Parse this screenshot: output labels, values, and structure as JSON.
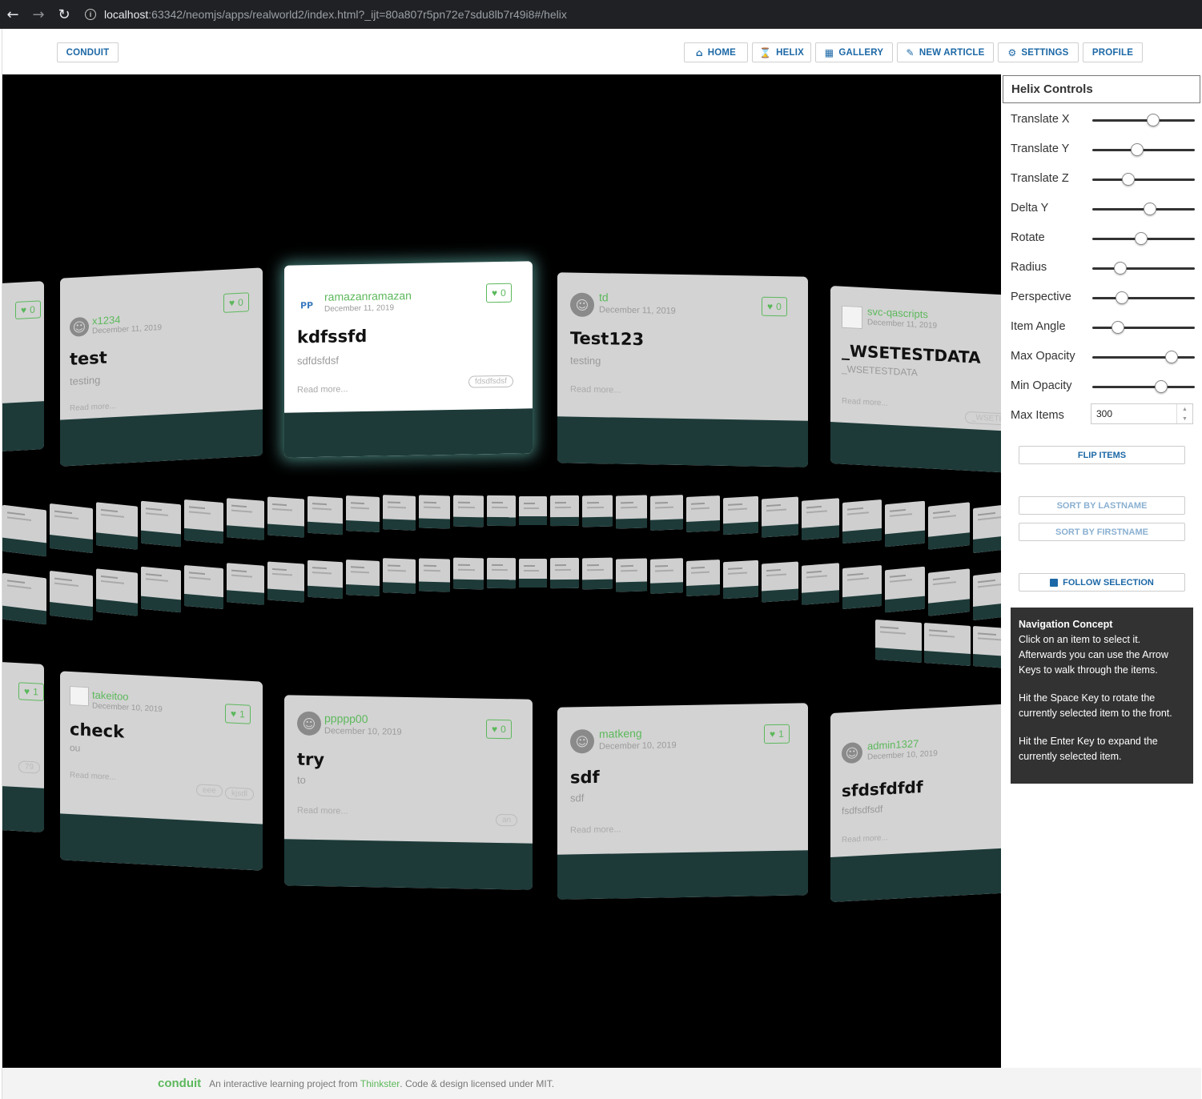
{
  "browser": {
    "url_host": "localhost",
    "url_rest": ":63342/neomjs/apps/realworld2/index.html?_ijt=80a807r5pn72e7sdu8lb7r49i8#/helix"
  },
  "nav": {
    "brand": "CONDUIT",
    "home": "HOME",
    "helix": "HELIX",
    "gallery": "GALLERY",
    "new_article": "NEW ARTICLE",
    "settings": "SETTINGS",
    "profile": "PROFILE"
  },
  "cards": [
    {
      "author": "x1234",
      "date": "December 11, 2019",
      "title": "test",
      "desc": "testing",
      "read": "Read more...",
      "fav": "0"
    },
    {
      "author": "ramazanramazan",
      "date": "December 11, 2019",
      "title": "kdfssfd",
      "desc": "sdfdsfdsf",
      "read": "Read more...",
      "fav": "0",
      "tag": "fdsdfsdsf",
      "avatar": "PP"
    },
    {
      "author": "td",
      "date": "December 11, 2019",
      "title": "Test123",
      "desc": "testing",
      "read": "Read more...",
      "fav": "0"
    },
    {
      "author": "svc-qascripts",
      "date": "December 11, 2019",
      "title": "_WSETESTDATA",
      "desc": "_WSETESTDATA",
      "read": "Read more...",
      "tag": "_WSETES"
    },
    {
      "author": "takeitoo",
      "date": "December 10, 2019",
      "title": "check",
      "desc": "ou",
      "read": "Read more...",
      "fav": "1",
      "tag": "eee",
      "tag2": "kjsdl"
    },
    {
      "author": "ppppp00",
      "date": "December 10, 2019",
      "title": "try",
      "desc": "to",
      "read": "Read more...",
      "fav": "0",
      "tag": "an"
    },
    {
      "author": "matkeng",
      "date": "December 10, 2019",
      "title": "sdf",
      "desc": "sdf",
      "read": "Read more...",
      "fav": "1"
    },
    {
      "author": "admin1327",
      "date": "December 10, 2019",
      "title": "sfdsfdfdf",
      "desc": "fsdfsdfsdf",
      "read": "Read more..."
    }
  ],
  "edge_cards": {
    "left_top_fav": "0",
    "left_bottom_fav": "1",
    "left_bottom_tag": "79"
  },
  "panel": {
    "title": "Helix Controls",
    "controls": [
      {
        "label": "Translate X",
        "value": 0.59
      },
      {
        "label": "Translate Y",
        "value": 0.44
      },
      {
        "label": "Translate Z",
        "value": 0.35
      },
      {
        "label": "Delta Y",
        "value": 0.56
      },
      {
        "label": "Rotate",
        "value": 0.48
      },
      {
        "label": "Radius",
        "value": 0.27
      },
      {
        "label": "Perspective",
        "value": 0.29
      },
      {
        "label": "Item Angle",
        "value": 0.25
      },
      {
        "label": "Max Opacity",
        "value": 0.77
      },
      {
        "label": "Min Opacity",
        "value": 0.67
      }
    ],
    "max_items_label": "Max Items",
    "max_items_value": "300",
    "flip_items": "FLIP ITEMS",
    "sort_lastname": "SORT BY LASTNAME",
    "sort_firstname": "SORT BY FIRSTNAME",
    "follow_selection": "FOLLOW SELECTION",
    "nav_concept": {
      "heading": "Navigation Concept",
      "p1": "Click on an item to select it. Afterwards you can use the Arrow Keys to walk through the items.",
      "p2": "Hit the Space Key to rotate the currently selected item to the front.",
      "p3": "Hit the Enter Key to expand the currently selected item."
    }
  },
  "footer": {
    "logo": "conduit",
    "text_before": "An interactive learning project from",
    "link": "Thinkster",
    "text_after": ". Code & design licensed under MIT."
  }
}
